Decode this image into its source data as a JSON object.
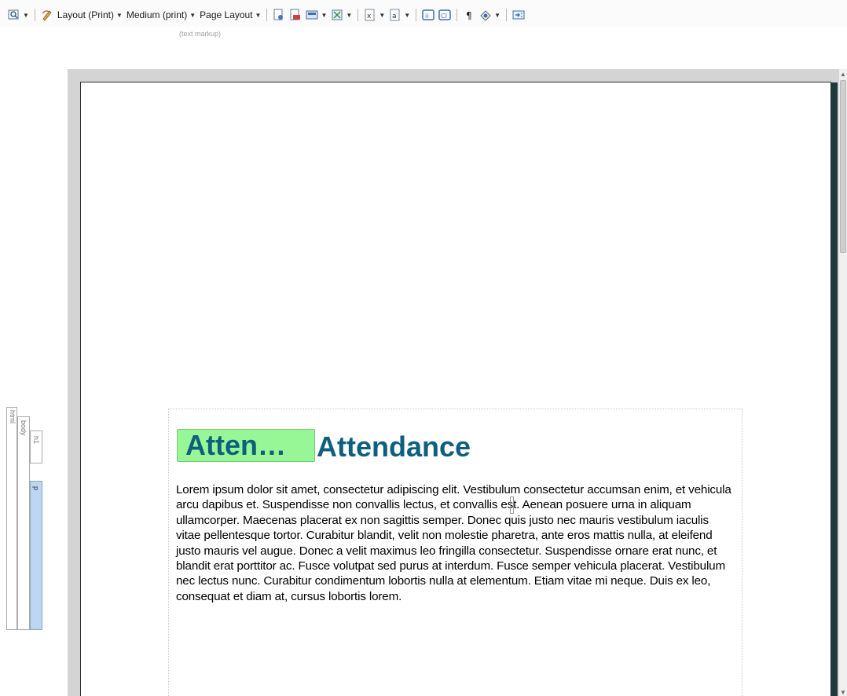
{
  "toolbar": {
    "layout_label": "Layout (Print)",
    "medium_label": "Medium (print)",
    "page_layout_label": "Page Layout",
    "subcaption": "(text markup)",
    "icons": [
      "zoom-icon",
      "spelling-icon",
      "page-icon",
      "print-preview-icon",
      "image-icon",
      "frame-icon",
      "insert-x-icon",
      "insert-a-icon",
      "info-icon",
      "ci-icon",
      "paragraph-mark-icon",
      "visibility-icon",
      "export-icon"
    ]
  },
  "breadcrumb": {
    "html": "html",
    "body": "body",
    "h1": "h1",
    "p": "p"
  },
  "document": {
    "h1_tag_label": "Atten…",
    "h1_text": "Attendance",
    "paragraph": "Lorem ipsum dolor sit amet, consectetur adipiscing elit. Vestibulum consectetur accumsan enim, et vehicula arcu dapibus et. Suspendisse non convallis lectus, et convallis est. Aenean posuere urna in aliquam ullamcorper. Maecenas placerat ex non sagittis semper. Donec quis justo nec mauris vestibulum iaculis vitae pellentesque tortor. Curabitur blandit, velit non molestie pharetra, ante eros mattis nulla, at eleifend justo mauris vel augue. Donec a velit maximus leo fringilla consectetur. Suspendisse ornare erat nunc, et blandit erat porttitor ac. Fusce volutpat sed purus at interdum. Fusce semper vehicula placerat. Vestibulum nec lectus nunc. Curabitur condimentum lobortis nulla at elementum. Etiam vitae mi neque. Duis ex leo, consequat et diam at, cursus lobortis lorem."
  },
  "colors": {
    "heading": "#0e5f7d",
    "tag_fill": "#97f797",
    "selected_strip": "#bcd7f3"
  }
}
